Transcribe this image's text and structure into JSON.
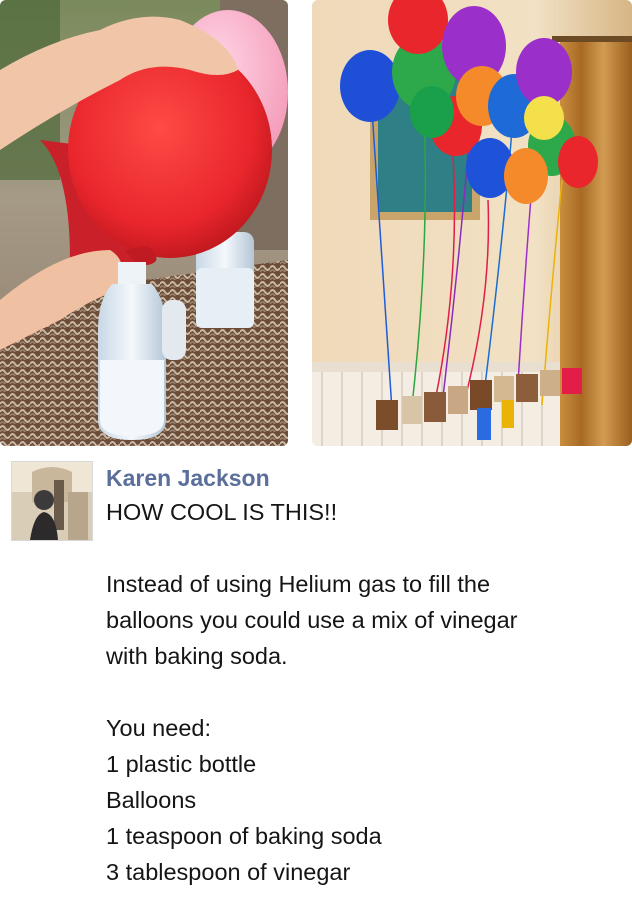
{
  "photos": {
    "left": {
      "icon": "balloon-on-bottle-photo"
    },
    "right": {
      "icon": "helium-balloons-photo"
    }
  },
  "post": {
    "avatar_icon": "profile-photo",
    "author": "Karen Jackson",
    "headline": "HOW COOL IS THIS!!",
    "paragraph": [
      "Instead of using Helium gas to fill the",
      "balloons you could use a mix of vinegar",
      "with baking soda."
    ],
    "list_heading": "You need:",
    "items": [
      "1 plastic bottle",
      "Balloons",
      "1 teaspoon of baking soda",
      "3 tablespoon of vinegar"
    ]
  },
  "colors": {
    "author_link": "#5b6f9c",
    "text": "#151515",
    "balloon_red": "#e8262c",
    "balloon_purple": "#9b2fc9"
  }
}
